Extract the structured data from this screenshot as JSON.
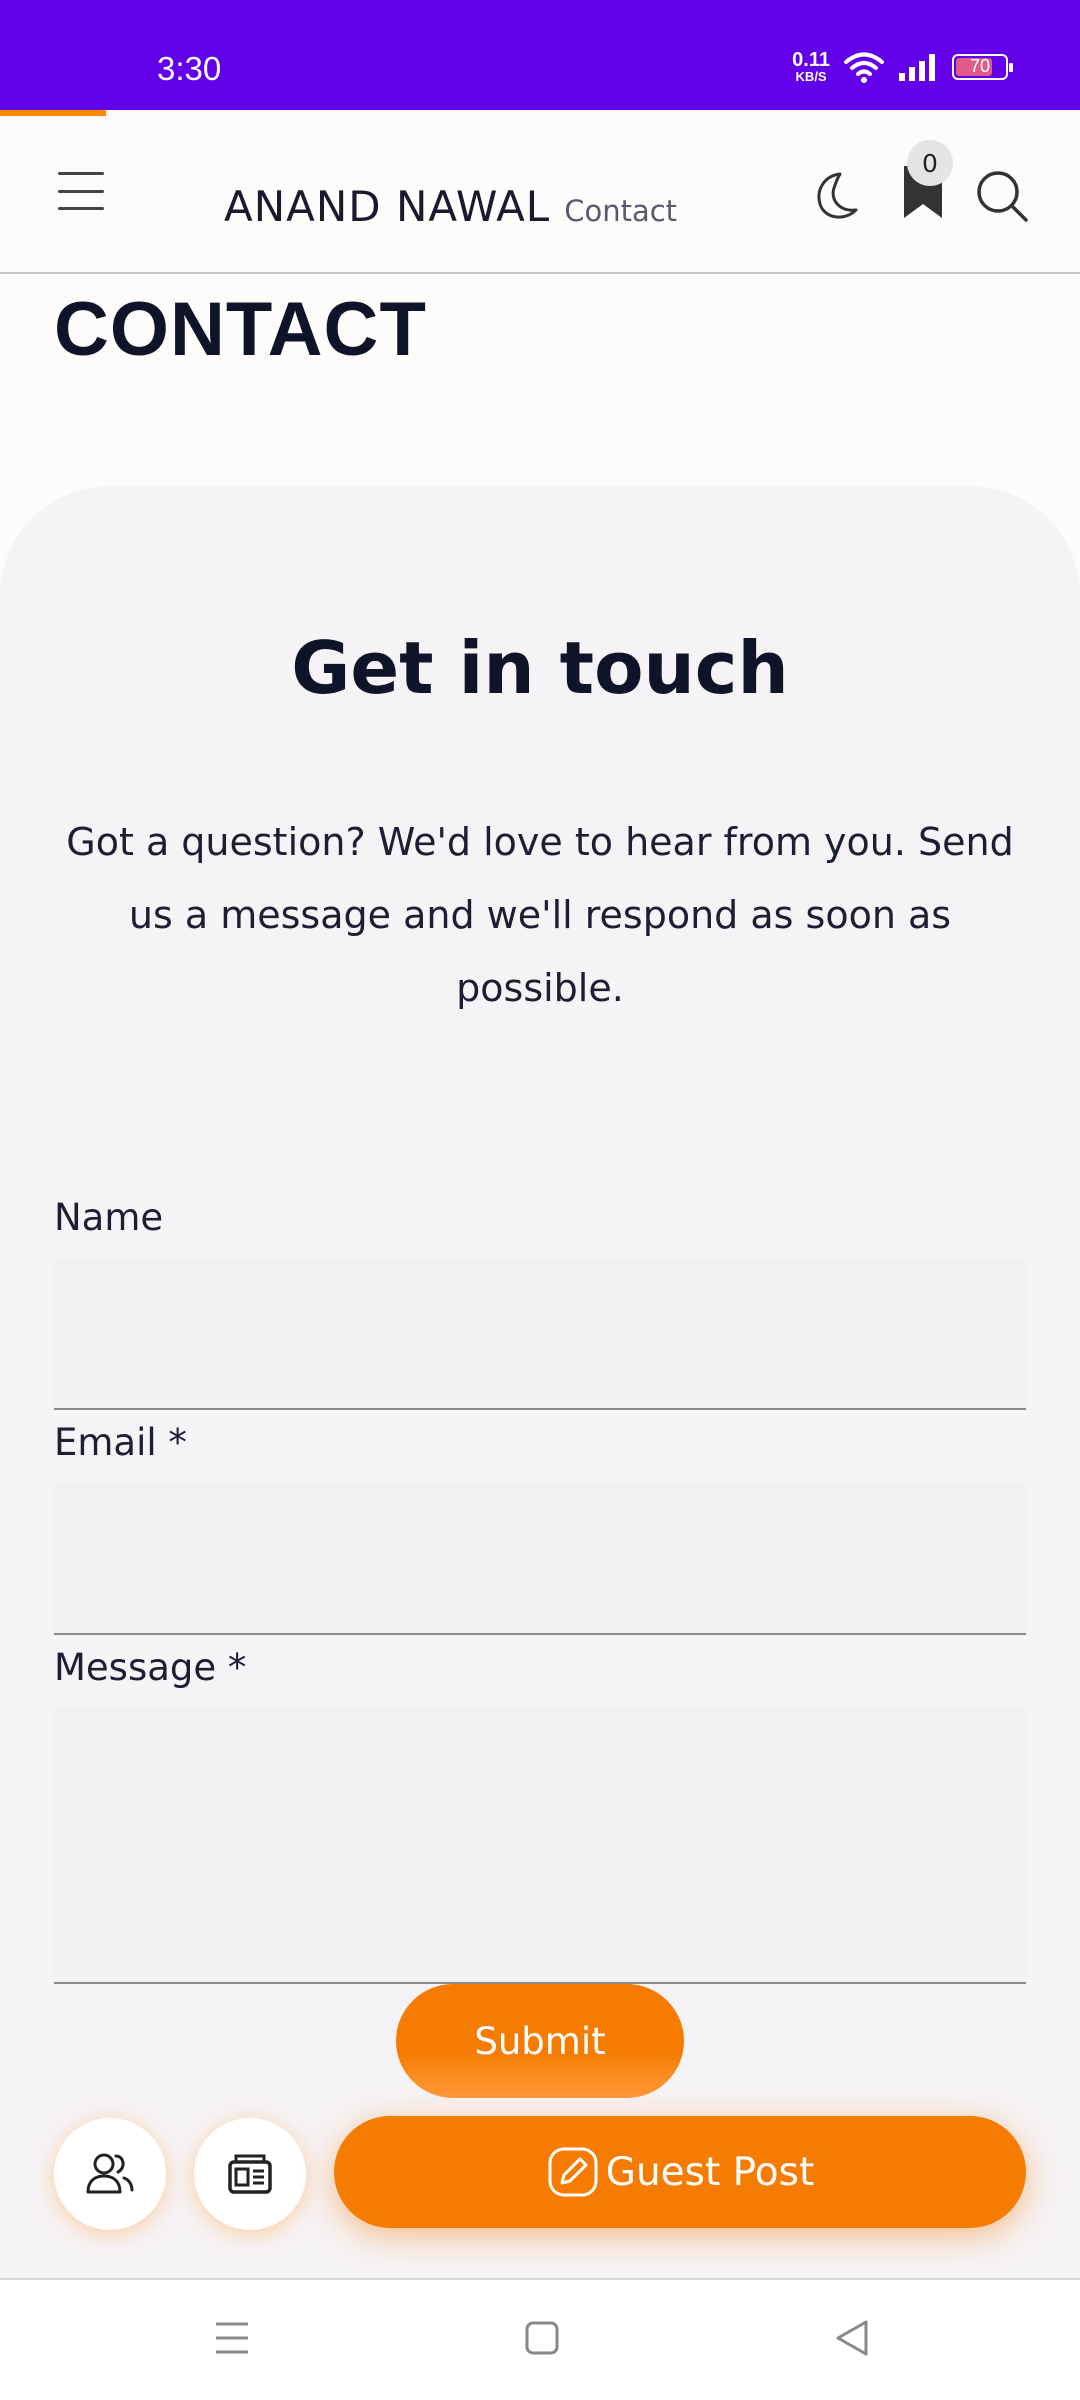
{
  "status_bar": {
    "time": "3:30",
    "net_speed_value": "0.11",
    "net_speed_unit": "KB/S",
    "battery": "70",
    "background_color": "#6200ea"
  },
  "header": {
    "brand_title": "ANAND NAWAL",
    "brand_subtitle": "Contact",
    "bookmark_count": "0",
    "icons": [
      "menu-icon",
      "moon-icon",
      "bookmark-icon",
      "search-icon"
    ]
  },
  "page": {
    "title": "CONTACT"
  },
  "contact": {
    "heading": "Get in touch",
    "intro": "Got a question? We'd love to hear from you. Send us a message and we'll respond as soon as possible.",
    "fields": {
      "name_label": "Name",
      "email_label": "Email *",
      "message_label": "Message *"
    },
    "submit_label": "Submit"
  },
  "bottom_actions": {
    "guest_post_label": "Guest Post",
    "accent_color": "#f57c00",
    "icons": [
      "users-icon",
      "news-icon",
      "edit-icon"
    ]
  },
  "nav_bar": {
    "icons": [
      "recents-icon",
      "home-icon",
      "back-icon"
    ]
  }
}
